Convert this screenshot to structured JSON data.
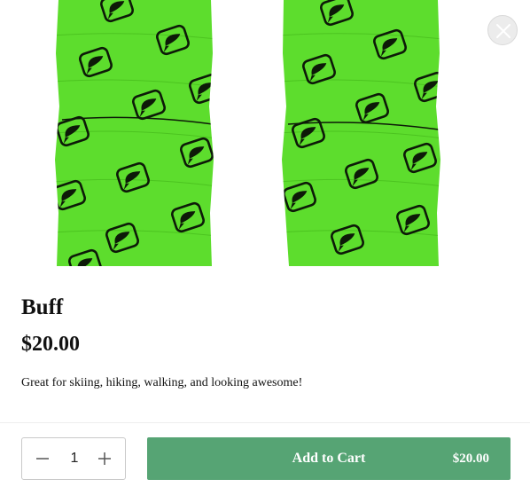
{
  "product": {
    "name": "Buff",
    "price": "$20.00",
    "description": "Great for skiing, hiking, walking, and looking awesome!",
    "image_color": "#5ddd2d",
    "pattern_icon": "speech-bubble-logo-icon"
  },
  "footer": {
    "quantity": "1",
    "add_to_cart_label": "Add to Cart",
    "add_to_cart_price": "$20.00",
    "button_color": "#56a474"
  },
  "icons": {
    "close": "close-icon",
    "minus": "minus-icon",
    "plus": "plus-icon"
  }
}
